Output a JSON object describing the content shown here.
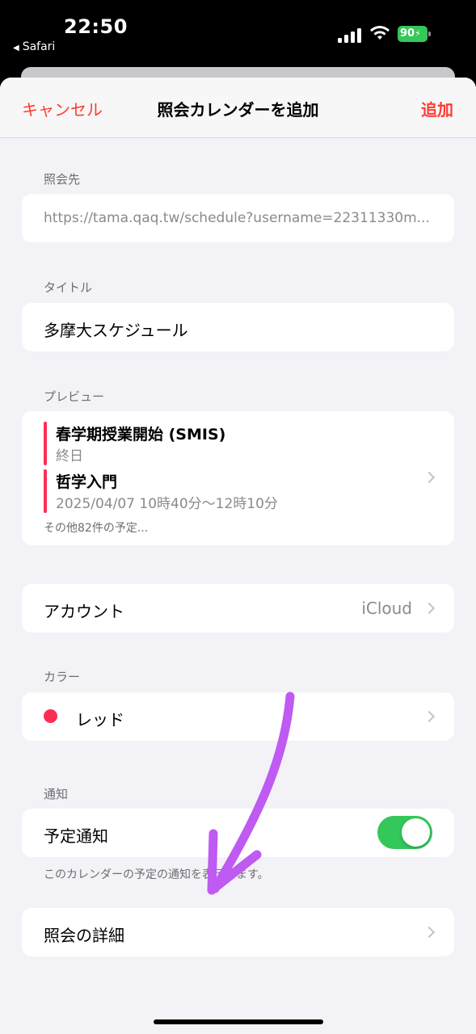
{
  "status_bar": {
    "time": "22:50",
    "back_app": "Safari",
    "battery": "90"
  },
  "navbar": {
    "cancel": "キャンセル",
    "title": "照会カレンダーを追加",
    "add": "追加"
  },
  "subscribe": {
    "label": "照会先",
    "url": "https://tama.qaq.tw/schedule?username=22311330m..."
  },
  "title_section": {
    "label": "タイトル",
    "value": "多摩大スケジュール"
  },
  "preview": {
    "label": "プレビュー",
    "events": [
      {
        "title": "春学期授業開始 (SMIS)",
        "sub": "終日"
      },
      {
        "title": "哲学入門",
        "sub": "2025/04/07 10時40分〜12時10分"
      }
    ],
    "more": "その他82件の予定..."
  },
  "account": {
    "label": "アカウント",
    "value": "iCloud"
  },
  "color_section": {
    "label": "カラー",
    "value": "レッド",
    "color": "#ff2d55"
  },
  "notification": {
    "label": "通知",
    "row": "予定通知",
    "enabled": true,
    "footnote": "このカレンダーの予定の通知を表示します。"
  },
  "details": {
    "label": "照会の詳細"
  },
  "colors": {
    "accent": "#ff3b30",
    "toggle_on": "#34c759",
    "annotation_arrow": "#bf5af2"
  }
}
